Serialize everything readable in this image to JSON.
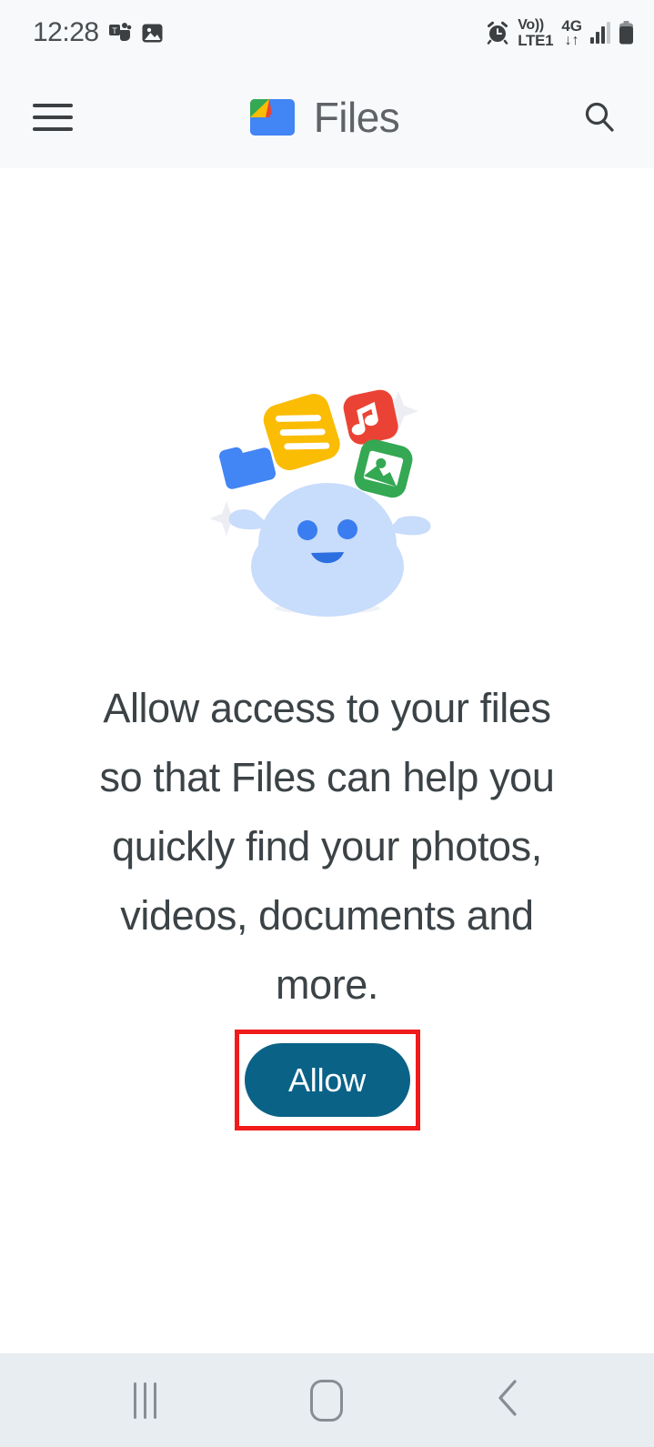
{
  "status_bar": {
    "time": "12:28",
    "left_icons": [
      {
        "name": "teams-icon",
        "label": "Microsoft Teams"
      },
      {
        "name": "image-icon",
        "label": "Image"
      }
    ],
    "right_icons": [
      {
        "name": "alarm-icon",
        "label": "Alarm"
      }
    ],
    "volte_line1": "Vo))",
    "volte_line2": "LTE1",
    "network_type": "4G",
    "data_arrows": "↓↑",
    "signal_label": "Signal strength",
    "battery_label": "Battery"
  },
  "app_bar": {
    "menu_label": "Menu",
    "logo_label": "files-app-logo",
    "title": "Files",
    "search_label": "Search"
  },
  "main": {
    "illustration_label": "files-mascot-illustration",
    "permission_text": "Allow access to your files so that Files can help you quickly find your photos, videos, documents and more.",
    "allow_button_label": "Allow",
    "highlight_color": "#f01b1b",
    "button_color": "#0a6287"
  },
  "nav_bar": {
    "recents_label": "Recents",
    "home_label": "Home",
    "back_label": "Back"
  }
}
